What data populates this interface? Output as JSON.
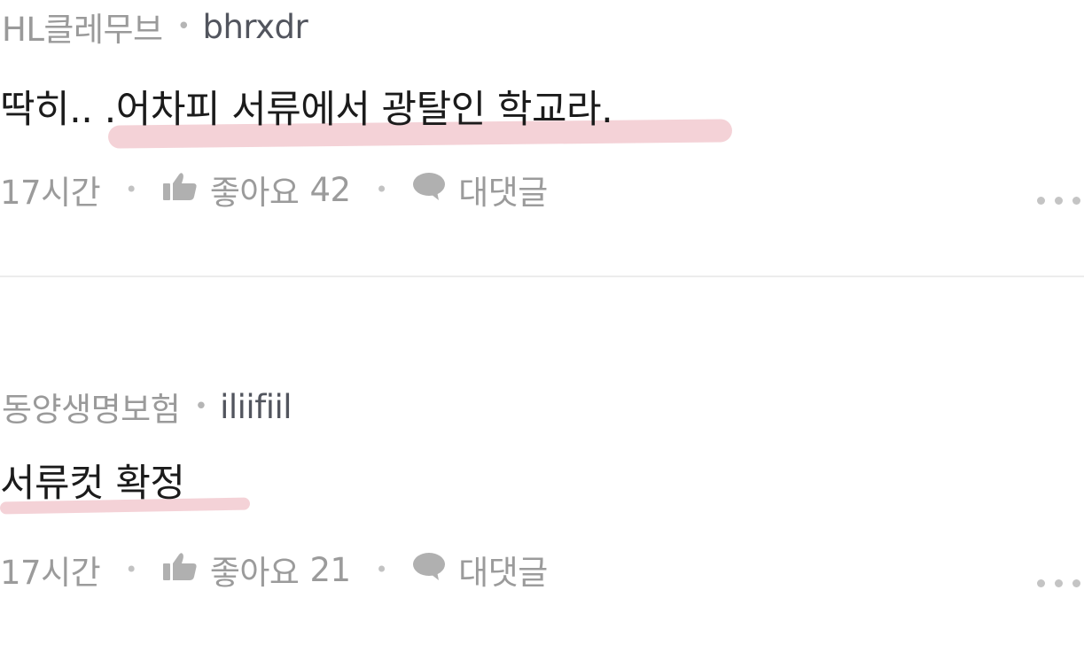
{
  "comments": [
    {
      "author": "HL클레무브",
      "separator": "•",
      "handle": "bhrxdr",
      "body": "딱히.. .어차피 서류에서 광탈인 학교라.",
      "time": "17시간",
      "like_label": "좋아요",
      "like_count": "42",
      "reply_label": "대댓글",
      "action_separator": "•"
    },
    {
      "author": "동양생명보험",
      "separator": "•",
      "handle": "iliifiil",
      "body": "서류컷 확정",
      "time": "17시간",
      "like_label": "좋아요",
      "like_count": "21",
      "reply_label": "대댓글",
      "action_separator": "•"
    }
  ],
  "icons": {
    "like": "thumbs-up-icon",
    "reply": "speech-bubble-icon",
    "more": "more-options-icon"
  },
  "colors": {
    "highlight": "#f3cdd3",
    "meta_text": "#9a9a9a",
    "handle_text": "#52555e",
    "body_text": "#1b1b1b",
    "divider": "#ececec"
  }
}
